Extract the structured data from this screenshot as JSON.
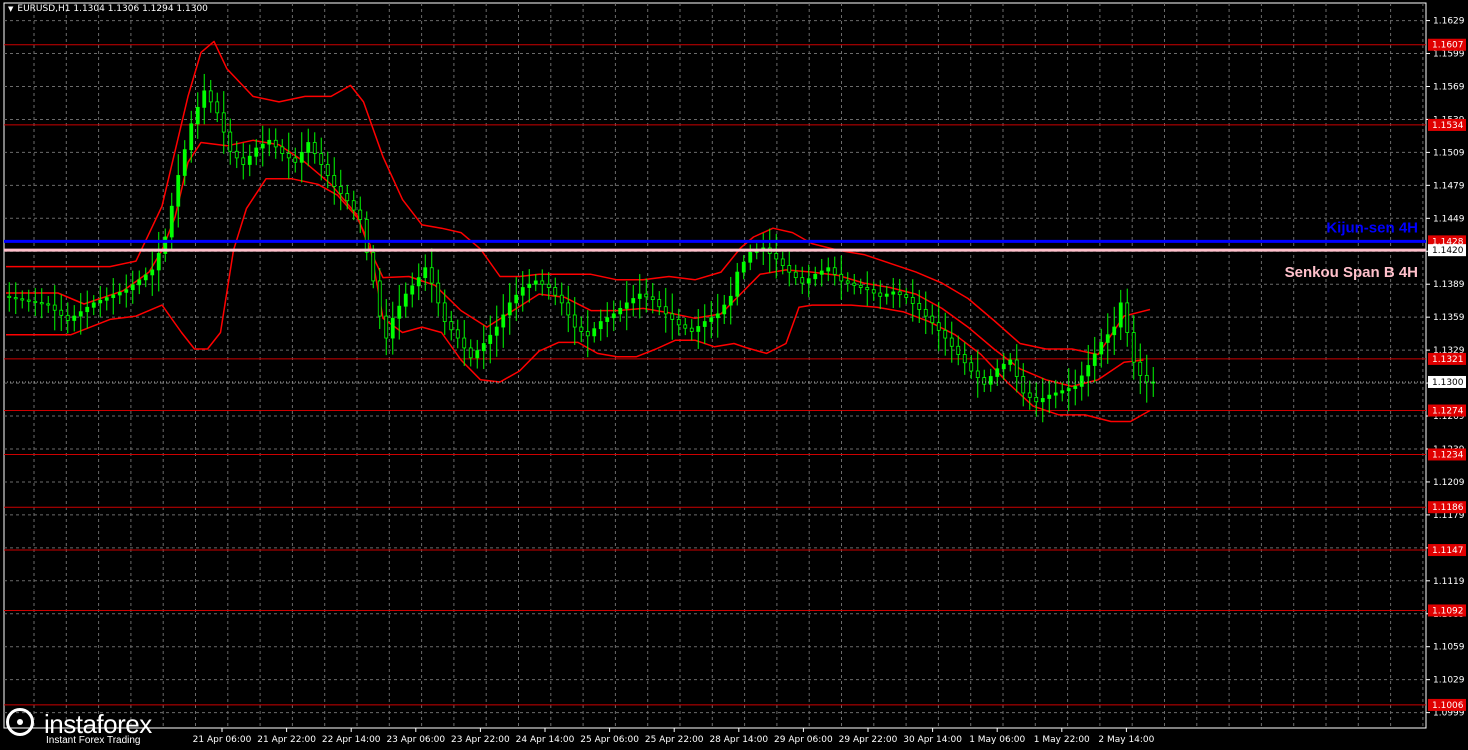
{
  "header": {
    "text": "EURUSD,H1  1.1304 1.1306 1.1294 1.1300"
  },
  "logo": {
    "name": "instaforex",
    "tagline": "Instant Forex Trading"
  },
  "colors": {
    "background": "#000000",
    "grid": "#6b6b6b",
    "axis_text": "#ffffff",
    "candle": "#00ff00",
    "indicator": "#ff0000",
    "level_line": "#cc0000",
    "kijun_line": "#0000ff",
    "senkou_line": "#ffc0cb",
    "current_price_bg": "#ffffff"
  },
  "chart_data": {
    "type": "line",
    "symbol": "EURUSD",
    "timeframe": "H1",
    "ylim": [
      1.0985,
      1.1645
    ],
    "y_ticks": [
      "1.0999",
      "1.1029",
      "1.1059",
      "1.1089",
      "1.1119",
      "1.1149",
      "1.1179",
      "1.1209",
      "1.1239",
      "1.1269",
      "1.1299",
      "1.1329",
      "1.1359",
      "1.1389",
      "1.1419",
      "1.1449",
      "1.1479",
      "1.1509",
      "1.1539",
      "1.1569",
      "1.1599",
      "1.1629"
    ],
    "x_ticks": [
      "21 Apr 06:00",
      "21 Apr 22:00",
      "22 Apr 14:00",
      "23 Apr 06:00",
      "23 Apr 22:00",
      "24 Apr 14:00",
      "25 Apr 06:00",
      "25 Apr 22:00",
      "28 Apr 14:00",
      "29 Apr 06:00",
      "29 Apr 22:00",
      "30 Apr 14:00",
      "1 May 06:00",
      "1 May 22:00",
      "2 May 14:00"
    ],
    "current_price": "1.1300",
    "levels": [
      {
        "label": "1.1607",
        "value": 1.1607
      },
      {
        "label": "1.1534",
        "value": 1.1534
      },
      {
        "label": "1.1321",
        "value": 1.1321
      },
      {
        "label": "1.1274",
        "value": 1.1274
      },
      {
        "label": "1.1234",
        "value": 1.1234
      },
      {
        "label": "1.1186",
        "value": 1.1186
      },
      {
        "label": "1.1147",
        "value": 1.1147
      },
      {
        "label": "1.1092",
        "value": 1.1092
      },
      {
        "label": "1.1006",
        "value": 1.1006
      }
    ],
    "kijun": {
      "label": "1.1428",
      "value": 1.1428,
      "name": "Kijun-sen 4H"
    },
    "senkou": {
      "label": "1.1420",
      "value": 1.142,
      "name": "Senkou Span B 4H"
    },
    "price_path": [
      [
        0,
        1.1378
      ],
      [
        7,
        1.137
      ],
      [
        10,
        1.1356
      ],
      [
        14,
        1.1372
      ],
      [
        19,
        1.1384
      ],
      [
        23,
        1.1402
      ],
      [
        25,
        1.1432
      ],
      [
        27,
        1.1488
      ],
      [
        29,
        1.1535
      ],
      [
        31,
        1.1565
      ],
      [
        33,
        1.1545
      ],
      [
        35,
        1.151
      ],
      [
        37,
        1.1498
      ],
      [
        39,
        1.1513
      ],
      [
        41,
        1.152
      ],
      [
        43,
        1.1508
      ],
      [
        45,
        1.15
      ],
      [
        47,
        1.1518
      ],
      [
        49,
        1.1498
      ],
      [
        51,
        1.1478
      ],
      [
        53,
        1.1465
      ],
      [
        55,
        1.1448
      ],
      [
        56,
        1.1418
      ],
      [
        57,
        1.1392
      ],
      [
        58,
        1.136
      ],
      [
        59,
        1.134
      ],
      [
        60,
        1.1358
      ],
      [
        62,
        1.138
      ],
      [
        64,
        1.1395
      ],
      [
        65,
        1.1404
      ],
      [
        66,
        1.139
      ],
      [
        67,
        1.1372
      ],
      [
        68,
        1.1355
      ],
      [
        70,
        1.134
      ],
      [
        72,
        1.1322
      ],
      [
        74,
        1.1335
      ],
      [
        76,
        1.135
      ],
      [
        78,
        1.1372
      ],
      [
        80,
        1.1386
      ],
      [
        82,
        1.1392
      ],
      [
        84,
        1.1386
      ],
      [
        86,
        1.1372
      ],
      [
        88,
        1.135
      ],
      [
        90,
        1.1342
      ],
      [
        92,
        1.1355
      ],
      [
        94,
        1.1362
      ],
      [
        96,
        1.1372
      ],
      [
        98,
        1.138
      ],
      [
        100,
        1.1375
      ],
      [
        102,
        1.1362
      ],
      [
        104,
        1.1352
      ],
      [
        106,
        1.1346
      ],
      [
        108,
        1.1355
      ],
      [
        110,
        1.1362
      ],
      [
        112,
        1.1378
      ],
      [
        113,
        1.14
      ],
      [
        115,
        1.1418
      ],
      [
        117,
        1.1422
      ],
      [
        119,
        1.1412
      ],
      [
        121,
        1.14
      ],
      [
        123,
        1.139
      ],
      [
        125,
        1.1398
      ],
      [
        127,
        1.1404
      ],
      [
        129,
        1.1392
      ],
      [
        131,
        1.1388
      ],
      [
        133,
        1.1384
      ],
      [
        135,
        1.1378
      ],
      [
        137,
        1.1382
      ],
      [
        139,
        1.1377
      ],
      [
        141,
        1.1366
      ],
      [
        143,
        1.1354
      ],
      [
        145,
        1.134
      ],
      [
        147,
        1.1325
      ],
      [
        149,
        1.131
      ],
      [
        151,
        1.1298
      ],
      [
        153,
        1.1312
      ],
      [
        155,
        1.132
      ],
      [
        157,
        1.129
      ],
      [
        159,
        1.1282
      ],
      [
        161,
        1.1288
      ],
      [
        163,
        1.1292
      ],
      [
        165,
        1.1296
      ],
      [
        167,
        1.1315
      ],
      [
        169,
        1.1336
      ],
      [
        171,
        1.135
      ],
      [
        172,
        1.1372
      ],
      [
        173,
        1.1345
      ],
      [
        174,
        1.1318
      ],
      [
        175,
        1.1306
      ],
      [
        176,
        1.13
      ]
    ],
    "kijun_path": [
      [
        0,
        1.1381
      ],
      [
        8,
        1.1381
      ],
      [
        12,
        1.1371
      ],
      [
        18,
        1.1383
      ],
      [
        22,
        1.14
      ],
      [
        24,
        1.142
      ],
      [
        26,
        1.145
      ],
      [
        28,
        1.15
      ],
      [
        30,
        1.1518
      ],
      [
        34,
        1.1515
      ],
      [
        38,
        1.152
      ],
      [
        42,
        1.1516
      ],
      [
        46,
        1.15
      ],
      [
        50,
        1.148
      ],
      [
        54,
        1.1452
      ],
      [
        56,
        1.142
      ],
      [
        58,
        1.1395
      ],
      [
        62,
        1.1396
      ],
      [
        66,
        1.1388
      ],
      [
        70,
        1.1365
      ],
      [
        74,
        1.135
      ],
      [
        78,
        1.1365
      ],
      [
        82,
        1.138
      ],
      [
        86,
        1.1377
      ],
      [
        90,
        1.1365
      ],
      [
        94,
        1.1365
      ],
      [
        98,
        1.1367
      ],
      [
        102,
        1.1363
      ],
      [
        106,
        1.1358
      ],
      [
        110,
        1.1362
      ],
      [
        113,
        1.138
      ],
      [
        116,
        1.1398
      ],
      [
        120,
        1.1402
      ],
      [
        124,
        1.14
      ],
      [
        128,
        1.1397
      ],
      [
        132,
        1.139
      ],
      [
        136,
        1.1386
      ],
      [
        140,
        1.138
      ],
      [
        144,
        1.1367
      ],
      [
        148,
        1.135
      ],
      [
        152,
        1.133
      ],
      [
        156,
        1.1312
      ],
      [
        160,
        1.1302
      ],
      [
        164,
        1.1296
      ],
      [
        168,
        1.1302
      ],
      [
        172,
        1.1318
      ],
      [
        175,
        1.132
      ]
    ],
    "bb_upper_path": [
      [
        0,
        1.1405
      ],
      [
        10,
        1.1405
      ],
      [
        16,
        1.1405
      ],
      [
        20,
        1.141
      ],
      [
        24,
        1.146
      ],
      [
        28,
        1.156
      ],
      [
        30,
        1.16
      ],
      [
        32,
        1.161
      ],
      [
        34,
        1.1585
      ],
      [
        38,
        1.156
      ],
      [
        42,
        1.1555
      ],
      [
        46,
        1.156
      ],
      [
        50,
        1.156
      ],
      [
        53,
        1.157
      ],
      [
        55,
        1.1555
      ],
      [
        58,
        1.1505
      ],
      [
        61,
        1.1466
      ],
      [
        64,
        1.1443
      ],
      [
        67,
        1.144
      ],
      [
        70,
        1.1436
      ],
      [
        73,
        1.1421
      ],
      [
        76,
        1.1396
      ],
      [
        79,
        1.1396
      ],
      [
        82,
        1.1398
      ],
      [
        86,
        1.1398
      ],
      [
        90,
        1.1398
      ],
      [
        94,
        1.1393
      ],
      [
        98,
        1.1393
      ],
      [
        102,
        1.1396
      ],
      [
        106,
        1.1393
      ],
      [
        110,
        1.14
      ],
      [
        113,
        1.1422
      ],
      [
        115,
        1.1432
      ],
      [
        118,
        1.144
      ],
      [
        121,
        1.1436
      ],
      [
        124,
        1.1426
      ],
      [
        128,
        1.142
      ],
      [
        132,
        1.1416
      ],
      [
        136,
        1.1408
      ],
      [
        140,
        1.14
      ],
      [
        144,
        1.139
      ],
      [
        148,
        1.1376
      ],
      [
        152,
        1.1356
      ],
      [
        156,
        1.1335
      ],
      [
        160,
        1.133
      ],
      [
        164,
        1.133
      ],
      [
        168,
        1.1325
      ],
      [
        172,
        1.136
      ],
      [
        176,
        1.1366
      ]
    ],
    "bb_lower_path": [
      [
        0,
        1.1343
      ],
      [
        10,
        1.1343
      ],
      [
        16,
        1.1357
      ],
      [
        20,
        1.136
      ],
      [
        24,
        1.137
      ],
      [
        27,
        1.1345
      ],
      [
        29,
        1.133
      ],
      [
        31,
        1.133
      ],
      [
        33,
        1.1345
      ],
      [
        35,
        1.142
      ],
      [
        37,
        1.1458
      ],
      [
        40,
        1.1485
      ],
      [
        44,
        1.1485
      ],
      [
        48,
        1.148
      ],
      [
        51,
        1.147
      ],
      [
        54,
        1.145
      ],
      [
        56,
        1.1425
      ],
      [
        58,
        1.1358
      ],
      [
        61,
        1.1345
      ],
      [
        64,
        1.135
      ],
      [
        67,
        1.1345
      ],
      [
        70,
        1.132
      ],
      [
        73,
        1.1302
      ],
      [
        76,
        1.13
      ],
      [
        79,
        1.131
      ],
      [
        82,
        1.1328
      ],
      [
        85,
        1.1336
      ],
      [
        88,
        1.1336
      ],
      [
        91,
        1.1326
      ],
      [
        94,
        1.1323
      ],
      [
        97,
        1.1323
      ],
      [
        100,
        1.133
      ],
      [
        103,
        1.1338
      ],
      [
        106,
        1.1338
      ],
      [
        109,
        1.1332
      ],
      [
        112,
        1.1335
      ],
      [
        114,
        1.1331
      ],
      [
        117,
        1.1326
      ],
      [
        120,
        1.1335
      ],
      [
        122,
        1.1368
      ],
      [
        124,
        1.137
      ],
      [
        127,
        1.137
      ],
      [
        130,
        1.137
      ],
      [
        134,
        1.1368
      ],
      [
        138,
        1.1364
      ],
      [
        142,
        1.1355
      ],
      [
        146,
        1.1343
      ],
      [
        150,
        1.1325
      ],
      [
        154,
        1.13
      ],
      [
        158,
        1.1278
      ],
      [
        162,
        1.127
      ],
      [
        166,
        1.127
      ],
      [
        170,
        1.1264
      ],
      [
        173,
        1.1264
      ],
      [
        176,
        1.1274
      ]
    ]
  }
}
